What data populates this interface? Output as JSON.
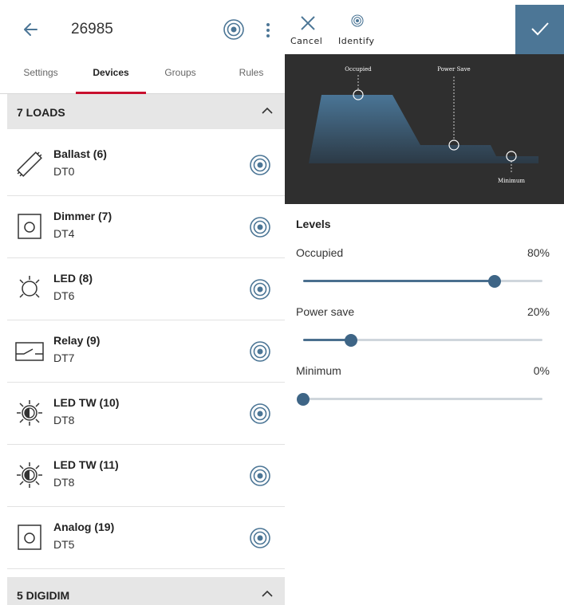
{
  "header": {
    "title": "26985"
  },
  "tabs": [
    {
      "label": "Settings",
      "active": false
    },
    {
      "label": "Devices",
      "active": true
    },
    {
      "label": "Groups",
      "active": false
    },
    {
      "label": "Rules",
      "active": false
    }
  ],
  "sections": [
    {
      "title": "7 LOADS",
      "expanded": true
    },
    {
      "title": "5 DIGIDIM",
      "expanded": true
    }
  ],
  "loads": [
    {
      "name": "Ballast (6)",
      "type": "DT0",
      "icon": "ballast-icon"
    },
    {
      "name": "Dimmer (7)",
      "type": "DT4",
      "icon": "dimmer-icon"
    },
    {
      "name": "LED (8)",
      "type": "DT6",
      "icon": "led-icon"
    },
    {
      "name": "Relay (9)",
      "type": "DT7",
      "icon": "relay-icon"
    },
    {
      "name": "LED TW (10)",
      "type": "DT8",
      "icon": "led-tw-icon"
    },
    {
      "name": "LED TW (11)",
      "type": "DT8",
      "icon": "led-tw-icon"
    },
    {
      "name": "Analog (19)",
      "type": "DT5",
      "icon": "analog-icon"
    }
  ],
  "actions": {
    "cancel_label": "Cancel",
    "identify_label": "Identify"
  },
  "profile_chart": {
    "occupied_label": "Occupied",
    "power_save_label": "Power Save",
    "minimum_label": "Minimum"
  },
  "levels": {
    "title": "Levels",
    "items": [
      {
        "label": "Occupied",
        "value_text": "80%",
        "value": 80
      },
      {
        "label": "Power save",
        "value_text": "20%",
        "value": 20
      },
      {
        "label": "Minimum",
        "value_text": "0%",
        "value": 0
      }
    ]
  },
  "colors": {
    "accent": "#c8102e",
    "primary": "#4c7696",
    "slider_fill": "#4a6f8e",
    "chart_bg": "#2f2f2f"
  }
}
